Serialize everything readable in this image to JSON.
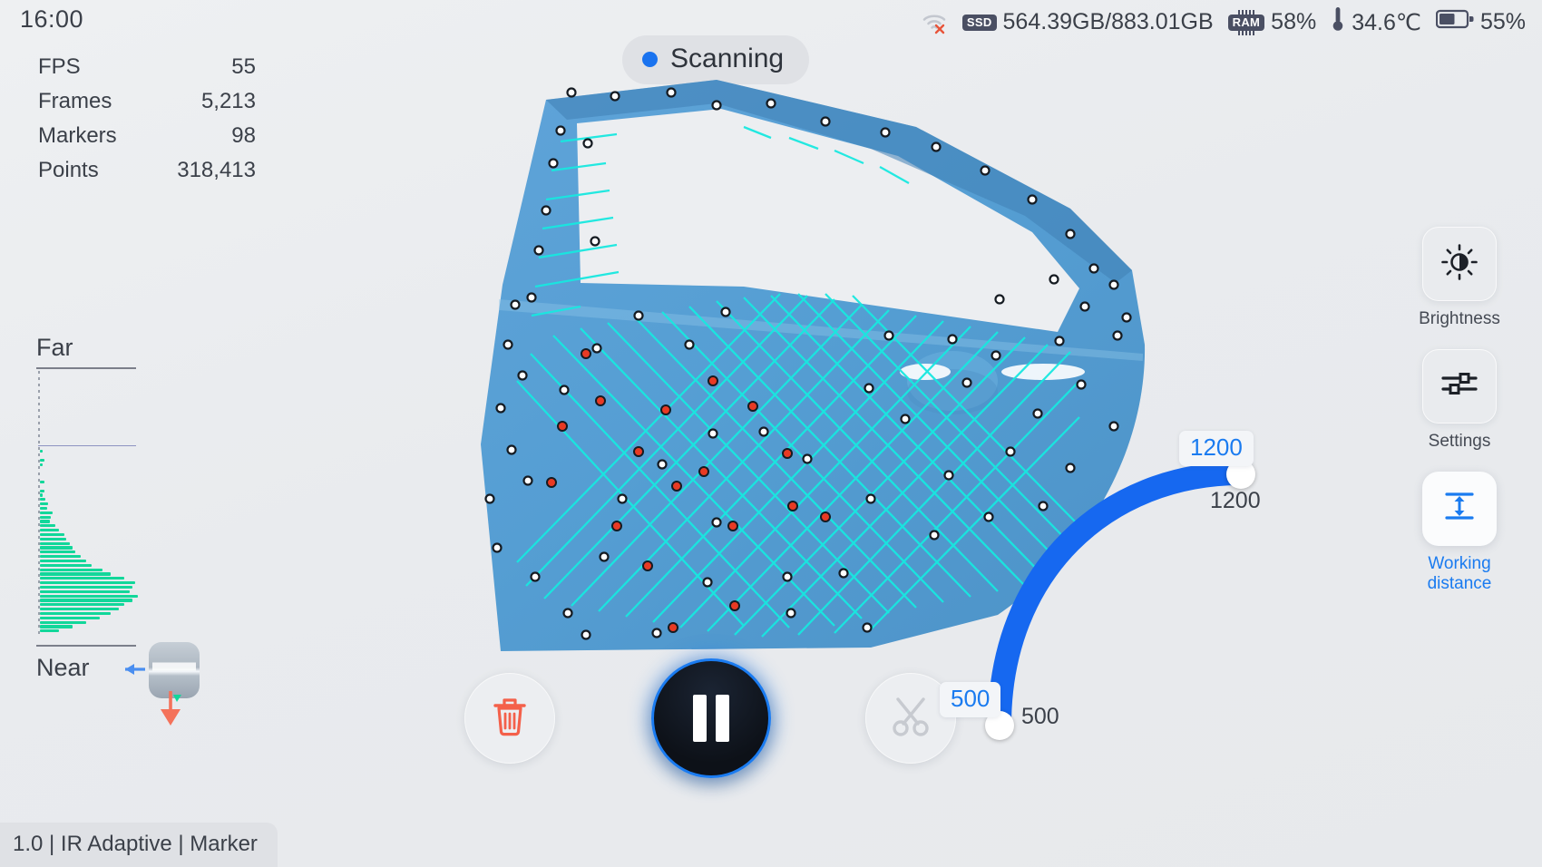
{
  "topbar": {
    "clock": "16:00",
    "wifi_icon": "wifi-off-icon",
    "ssd_badge": "SSD",
    "ssd_value": "564.39GB/883.01GB",
    "ram_badge": "RAM",
    "ram_value": "58%",
    "temp_icon": "thermometer-icon",
    "temp_value": "34.6℃",
    "battery_icon": "battery-icon",
    "battery_value": "55%",
    "battery_level_percent": 55
  },
  "status_badge": {
    "label": "Scanning",
    "dot_color": "#1a73ef"
  },
  "stats": {
    "rows": [
      {
        "key": "FPS",
        "value": "55"
      },
      {
        "key": "Frames",
        "value": "5,213"
      },
      {
        "key": "Markers",
        "value": "98"
      },
      {
        "key": "Points",
        "value": "318,413"
      }
    ]
  },
  "depth_gauge": {
    "far_label": "Far",
    "near_label": "Near",
    "bar_color": "#12d79a",
    "device_icon": "scanner-device-icon"
  },
  "chart_data": {
    "type": "bar",
    "title": "Depth distribution",
    "orientation": "horizontal",
    "xlabel": "",
    "ylabel": "",
    "ylim": [
      0,
      100
    ],
    "categories": [
      "Far",
      "",
      "",
      "",
      "",
      "",
      "",
      "",
      "",
      "",
      "",
      "",
      "",
      "",
      "",
      "",
      "",
      "",
      "",
      "",
      "",
      "",
      "",
      "",
      "",
      "",
      "",
      "",
      "",
      "",
      "",
      "",
      "",
      "",
      "",
      "",
      "",
      "",
      "",
      "",
      "",
      "",
      "Near"
    ],
    "values": [
      0,
      0,
      0,
      0,
      0,
      0,
      0,
      0,
      0,
      0,
      0,
      0,
      0,
      0,
      0,
      0,
      0,
      0,
      2,
      0,
      3,
      2,
      0,
      0,
      0,
      3,
      0,
      3,
      2,
      4,
      6,
      5,
      9,
      8,
      7,
      11,
      14,
      18,
      19,
      22,
      24,
      26,
      30,
      34,
      38,
      46,
      52,
      62,
      70,
      68,
      66,
      72,
      68,
      62,
      58,
      52,
      44,
      34,
      24,
      14
    ],
    "guide_line_index": 17,
    "guide_line_color": "#8e93c2",
    "grid": false,
    "legend": null
  },
  "mode_chip": {
    "text": "1.0 | IR Adaptive | Marker"
  },
  "viewport": {
    "mesh_name": "car-door-scan-mesh",
    "mesh_color": "#589bd0",
    "laser_line_color": "#18e8e0",
    "marker_active_color": "#e83a24",
    "marker_inactive_color": "#ffffff"
  },
  "controls": {
    "delete_icon": "trash-icon",
    "pause_icon": "pause-icon",
    "cut_icon": "scissors-icon"
  },
  "arc_slider": {
    "name": "working-distance-arc",
    "max_tip": "1200",
    "max_value": "1200",
    "min_tip": "500",
    "min_value": "500",
    "track_color": "#1668f0"
  },
  "rail": {
    "tools": [
      {
        "name": "brightness",
        "icon": "brightness-icon",
        "label": "Brightness",
        "active": false
      },
      {
        "name": "settings",
        "icon": "sliders-icon",
        "label": "Settings",
        "active": false
      },
      {
        "name": "working-distance",
        "icon": "working-distance-icon",
        "label": "Working\ndistance",
        "label_line1": "Working",
        "label_line2": "distance",
        "active": true
      }
    ]
  }
}
